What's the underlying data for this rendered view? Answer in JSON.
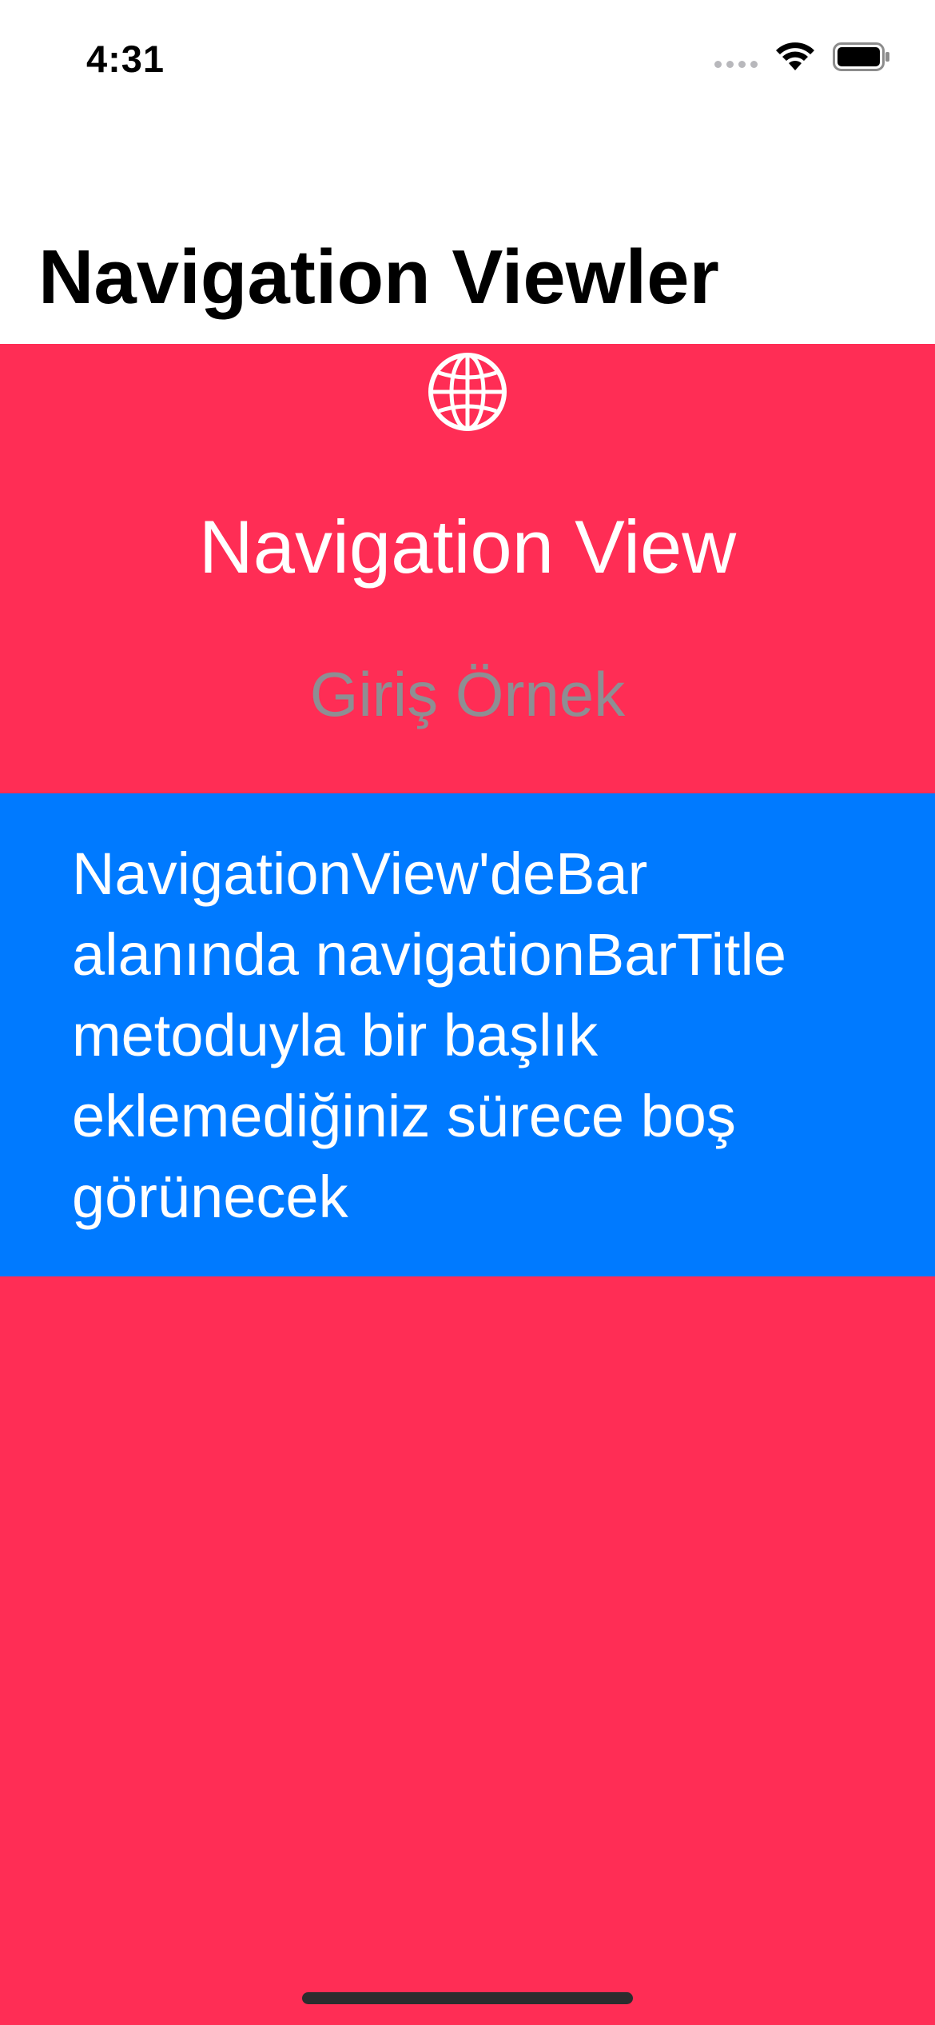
{
  "status_bar": {
    "time": "4:31",
    "icons": [
      "cellular-dots-icon",
      "wifi-icon",
      "battery-icon"
    ]
  },
  "nav": {
    "title": "Navigation Viewler"
  },
  "content": {
    "icon": "globe-icon",
    "title": "Navigation View",
    "subtitle": "Giriş Örnek",
    "info_text": "NavigationView'deBar alanında navigationBarTitle metoduyla bir başlık eklemediğiniz sürece boş görünecek"
  },
  "colors": {
    "background": "#ff2d55",
    "info_box": "#007aff",
    "subtitle": "#8e8e93",
    "text": "#ffffff"
  }
}
